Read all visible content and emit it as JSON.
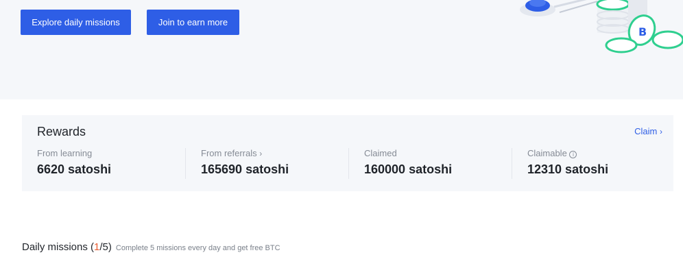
{
  "hero": {
    "explore_label": "Explore daily missions",
    "join_label": "Join to earn more",
    "accent": "#2e5ee6",
    "coin_green": "#2fcf8f",
    "coin_symbol": "B"
  },
  "rewards": {
    "title": "Rewards",
    "claim_label": "Claim",
    "stats": [
      {
        "label": "From learning",
        "value": "6620 satoshi"
      },
      {
        "label": "From referrals",
        "value": "165690 satoshi"
      },
      {
        "label": "Claimed",
        "value": "160000 satoshi"
      },
      {
        "label": "Claimable",
        "value": "12310 satoshi"
      }
    ]
  },
  "missions": {
    "title": "Daily missions",
    "open": "(",
    "done": "1",
    "sep": "/5)",
    "subtitle": "Complete 5 missions every day and get free BTC",
    "count_color": "#e8592e"
  }
}
